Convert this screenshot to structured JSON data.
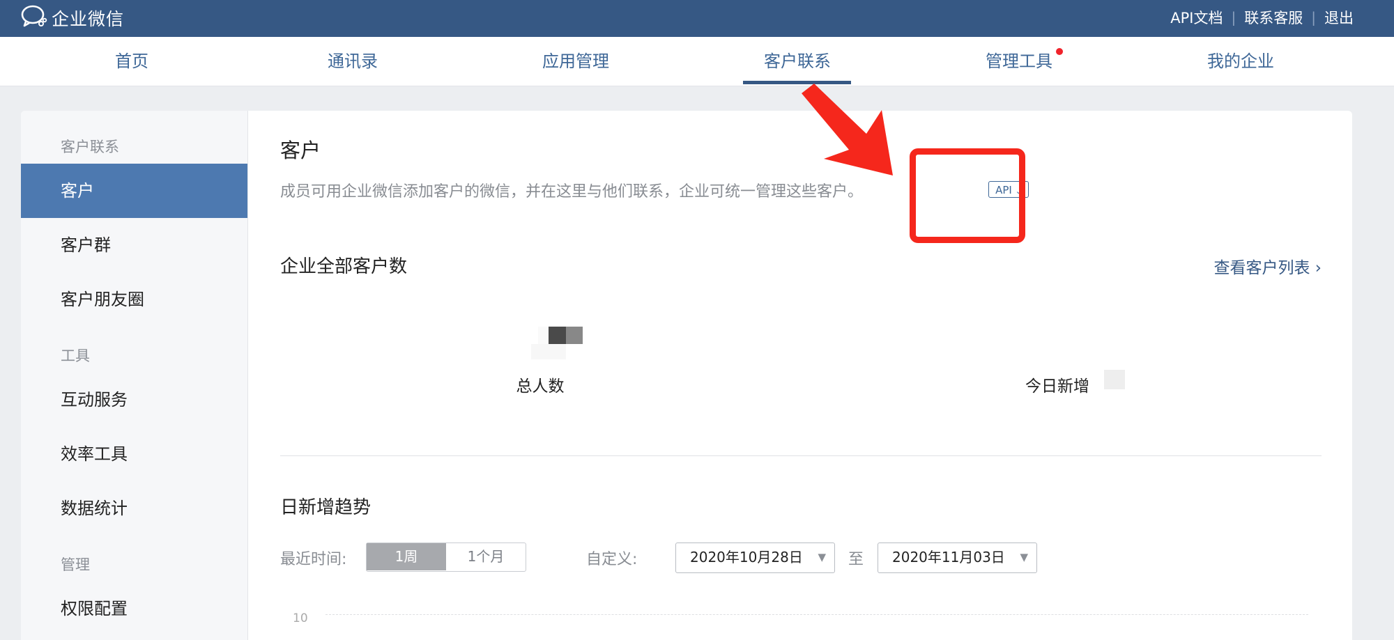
{
  "app": {
    "title": "企业微信",
    "links": [
      "API文档",
      "联系客服",
      "退出"
    ],
    "separator": "|"
  },
  "nav": {
    "items": [
      "首页",
      "通讯录",
      "应用管理",
      "客户联系",
      "管理工具",
      "我的企业"
    ],
    "active": "客户联系",
    "badge_on": "管理工具"
  },
  "sidebar": {
    "sections": [
      {
        "heading": "客户联系",
        "items": [
          "客户",
          "客户群",
          "客户朋友圈"
        ]
      },
      {
        "heading": "工具",
        "items": [
          "互动服务",
          "效率工具",
          "数据统计"
        ]
      },
      {
        "heading": "管理",
        "items": [
          "权限配置"
        ]
      }
    ],
    "active": "客户"
  },
  "main": {
    "title": "客户",
    "description": "成员可用企业微信添加客户的微信，并在这里与他们联系，企业可统一管理这些客户。",
    "api_tag": "API",
    "api_tag_icon": "chevron-down-icon",
    "count_section": {
      "title": "企业全部客户数",
      "link": "查看客户列表 ›",
      "total_label": "总人数",
      "today_label": "今日新增"
    },
    "trend_section": {
      "title": "日新增趋势",
      "recent_label": "最近时间:",
      "range_options": [
        "1周",
        "1个月"
      ],
      "active_range": "1周",
      "custom_label": "自定义:",
      "start_date": "2020年10月28日",
      "to_label": "至",
      "end_date": "2020年11月03日",
      "y_max_tick": "10"
    }
  },
  "colors": {
    "topbar": "#365884",
    "accent": "#3e6797",
    "sidebar_active": "#4d79b0",
    "annotation_red": "#f5271c",
    "badge_red": "#f0232b"
  }
}
